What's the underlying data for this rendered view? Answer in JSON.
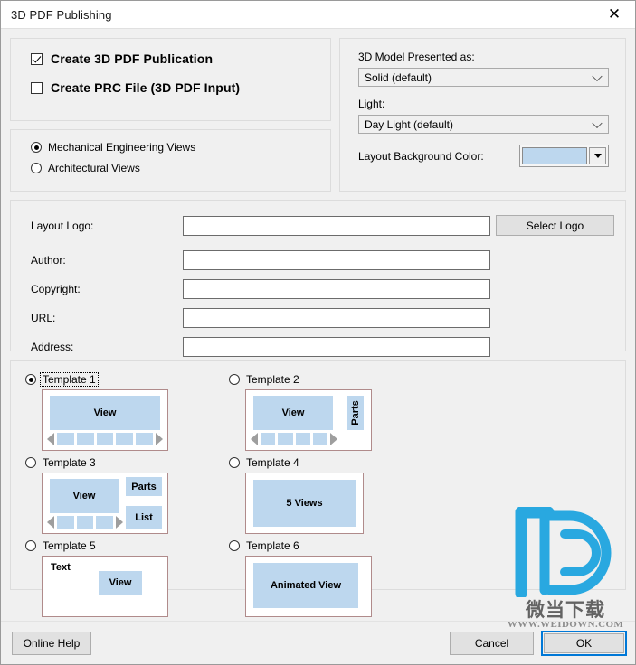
{
  "window": {
    "title": "3D PDF Publishing",
    "close_icon": "close-icon"
  },
  "create_group": {
    "items": [
      {
        "label": "Create 3D PDF Publication",
        "checked": true
      },
      {
        "label": "Create PRC File (3D PDF Input)",
        "checked": false
      }
    ]
  },
  "views_group": {
    "items": [
      {
        "label": "Mechanical Engineering Views",
        "selected": true
      },
      {
        "label": "Architectural Views",
        "selected": false
      }
    ]
  },
  "model_group": {
    "presented_as_label": "3D Model Presented as:",
    "presented_as_value": "Solid (default)",
    "light_label": "Light:",
    "light_value": "Day Light (default)",
    "background_label": "Layout Background Color:",
    "background_color": "#bdd7ee"
  },
  "meta_group": {
    "logo_label": "Layout Logo:",
    "logo_value": "",
    "logo_placeholder": "",
    "select_logo_button": "Select Logo",
    "fields": [
      {
        "label": "Author:",
        "value": "",
        "placeholder": ""
      },
      {
        "label": "Copyright:",
        "value": "",
        "placeholder": ""
      },
      {
        "label": "URL:",
        "value": "",
        "placeholder": ""
      },
      {
        "label": "Address:",
        "value": "",
        "placeholder": ""
      }
    ]
  },
  "templates": {
    "items": [
      {
        "label": "Template 1",
        "selected": true,
        "focused": true,
        "view_label": "View",
        "thumbnails": 5
      },
      {
        "label": "Template 2",
        "selected": false,
        "focused": false,
        "view_label": "View",
        "parts_label": "Parts",
        "thumbnails": 4
      },
      {
        "label": "Template 3",
        "selected": false,
        "focused": false,
        "view_label": "View",
        "parts_label": "Parts",
        "list_label": "List",
        "thumbnails": 3
      },
      {
        "label": "Template 4",
        "selected": false,
        "focused": false,
        "view_label": "5 Views"
      },
      {
        "label": "Template 5",
        "selected": false,
        "focused": false,
        "text_label": "Text",
        "view_label": "View"
      },
      {
        "label": "Template 6",
        "selected": false,
        "focused": false,
        "view_label": "Animated View"
      }
    ]
  },
  "watermark": {
    "text_cn": "微当下载",
    "url": "WWW.WEIDOWN.COM",
    "color": "#29a8e0"
  },
  "footer": {
    "online_help": "Online Help",
    "cancel": "Cancel",
    "ok": "OK"
  }
}
